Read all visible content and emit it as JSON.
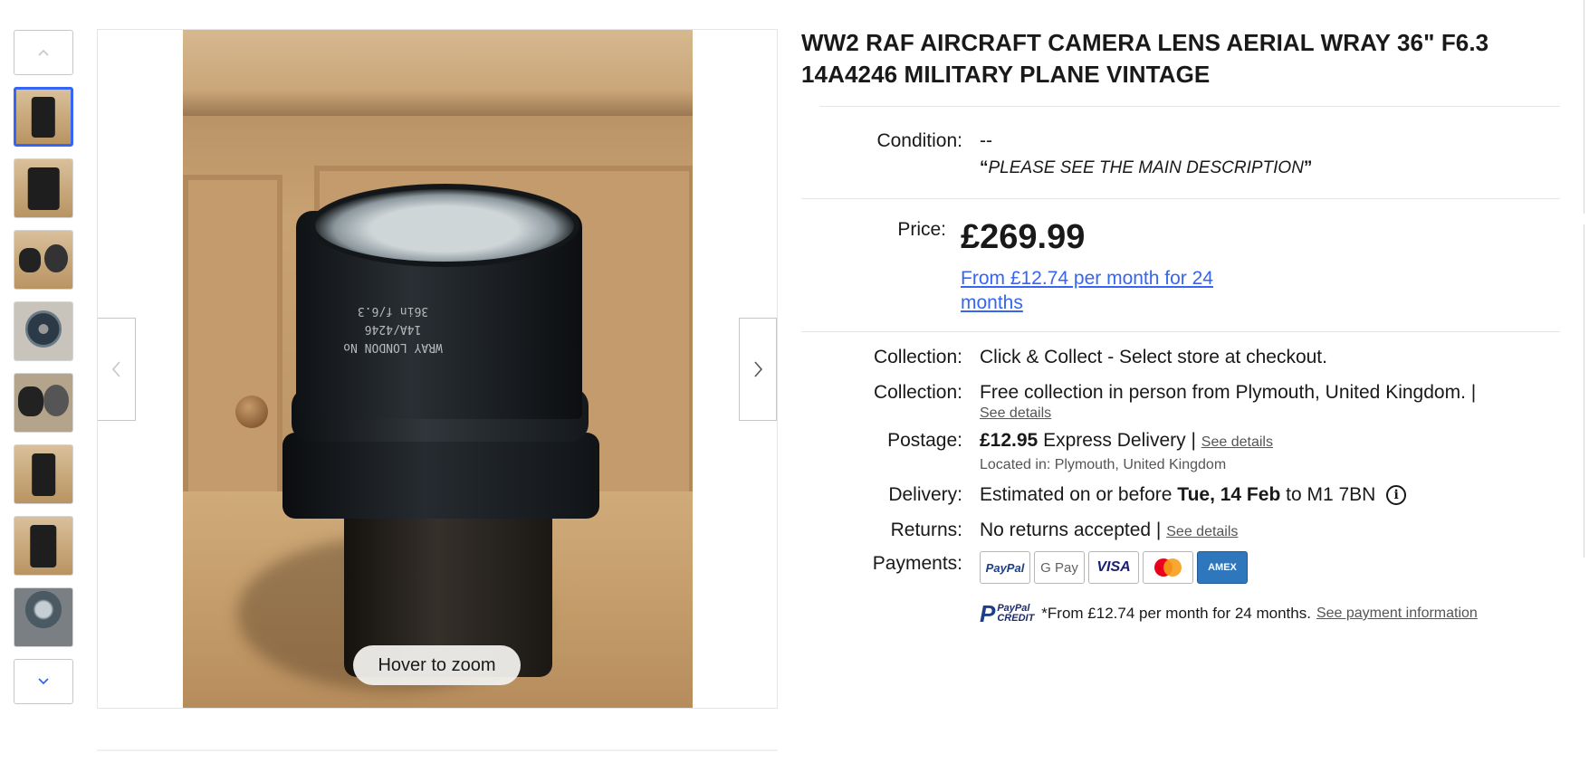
{
  "listing": {
    "title": "WW2 RAF AIRCRAFT CAMERA LENS AERIAL WRAY 36\" F6.3 14A4246 MILITARY PLANE VINTAGE"
  },
  "gallery": {
    "zoom_hint": "Hover to zoom",
    "engraving": [
      "WRAY LONDON No",
      "14A/4246",
      "36in f/6.3"
    ]
  },
  "condition": {
    "label": "Condition:",
    "value": "--",
    "note_open": "“",
    "note": "PLEASE SEE THE MAIN DESCRIPTION",
    "note_close": "”"
  },
  "price": {
    "label": "Price:",
    "value": "£269.99",
    "finance_link": "From £12.74 per month for 24 months"
  },
  "shipping": {
    "collection1_label": "Collection:",
    "collection1_value": "Click & Collect - Select store at checkout.",
    "collection2_label": "Collection:",
    "collection2_value": "Free collection in person from Plymouth, United Kingdom. |",
    "collection2_link": "See details",
    "postage_label": "Postage:",
    "postage_price": "£12.95",
    "postage_service": "Express Delivery",
    "postage_sep": "|",
    "postage_link": "See details",
    "located": "Located in: Plymouth, United Kingdom",
    "delivery_label": "Delivery:",
    "delivery_prefix": "Estimated on or before",
    "delivery_date": "Tue, 14 Feb",
    "delivery_to": "to M1 7BN",
    "returns_label": "Returns:",
    "returns_value": "No returns accepted |",
    "returns_link": "See details"
  },
  "payments": {
    "label": "Payments:",
    "methods": [
      "PayPal",
      "G Pay",
      "VISA",
      "mastercard",
      "AMEX"
    ],
    "paypal_credit_line1": "PayPal",
    "paypal_credit_line2": "CREDIT",
    "credit_text": "*From £12.74 per month for 24 months.",
    "credit_link": "See payment information"
  },
  "colors": {
    "link_blue": "#3665f3",
    "selected_border": "#3665f3",
    "visa_blue": "#1a1f71",
    "amex_blue": "#2e77bc",
    "mastercard_red": "#eb001b",
    "mastercard_orange": "#f79e1b"
  },
  "icons": [
    "chevron-up-icon",
    "chevron-down-icon",
    "chevron-left-icon",
    "chevron-right-icon",
    "info-icon",
    "paypal-credit-logo"
  ]
}
